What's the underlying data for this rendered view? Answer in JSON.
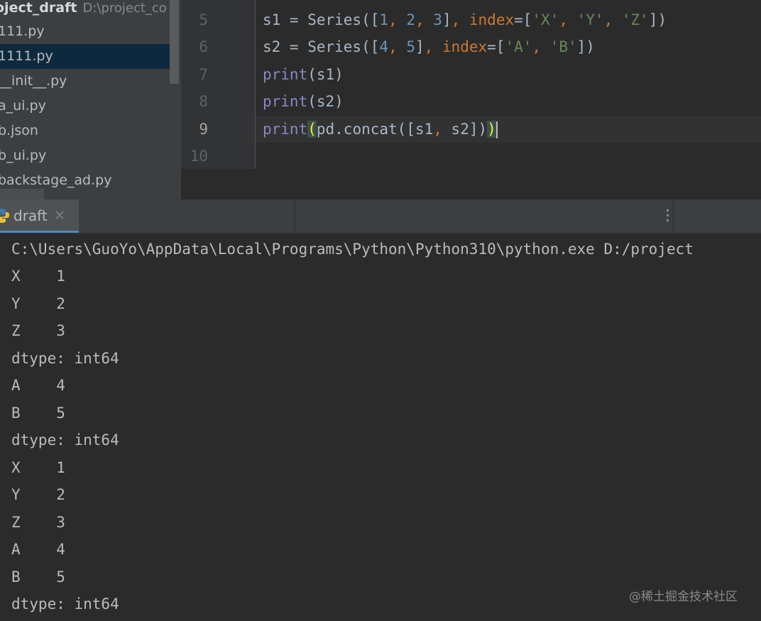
{
  "project": {
    "root_name": "oject_draft",
    "root_path": "D:\\project_co",
    "files": [
      {
        "name": "111.py",
        "selected": false
      },
      {
        "name": "1111.py",
        "selected": true
      },
      {
        "name": "__init__.py",
        "selected": false
      },
      {
        "name": "a_ui.py",
        "selected": false
      },
      {
        "name": "b.json",
        "selected": false
      },
      {
        "name": "b_ui.py",
        "selected": false
      },
      {
        "name": "backstage_ad.py",
        "selected": false
      }
    ]
  },
  "editor": {
    "line_numbers": [
      "5",
      "6",
      "7",
      "8",
      "9",
      "10"
    ],
    "current_line": "9",
    "lines": {
      "l5": {
        "a": "s1 = Series([",
        "n1": "1",
        "c1": ", ",
        "n2": "2",
        "c2": ", ",
        "n3": "3",
        "b": "]",
        "c3": ", ",
        "kw": "index",
        "eq": "=[",
        "s1": "'X'",
        "c4": ", ",
        "s2": "'Y'",
        "c5": ", ",
        "s3": "'Z'",
        "end": "])"
      },
      "l6": {
        "a": "s2 = Series([",
        "n1": "4",
        "c1": ", ",
        "n2": "5",
        "b": "]",
        "c2": ", ",
        "kw": "index",
        "eq": "=[",
        "s1": "'A'",
        "c3": ", ",
        "s2": "'B'",
        "end": "])"
      },
      "l7": {
        "fn": "print",
        "rest": "(s1)"
      },
      "l8": {
        "fn": "print",
        "rest": "(s2)"
      },
      "l9": {
        "fn": "print",
        "open": "(",
        "mid": "pd.concat([s1",
        "c1": ", ",
        "mid2": "s2])",
        "close": ")"
      }
    }
  },
  "run": {
    "tab_label": "draft",
    "console_lines": [
      "C:\\Users\\GuoYo\\AppData\\Local\\Programs\\Python\\Python310\\python.exe D:/project",
      "X    1",
      "Y    2",
      "Z    3",
      "dtype: int64",
      "A    4",
      "B    5",
      "dtype: int64",
      "X    1",
      "Y    2",
      "Z    3",
      "A    4",
      "B    5",
      "dtype: int64"
    ]
  },
  "watermark": "@稀土掘金技术社区",
  "colors": {
    "background": "#2b2b2b",
    "panel": "#3c3f41",
    "selection": "#0d293e",
    "keyword": "#cc7832",
    "string": "#6a8759",
    "number": "#6897bb",
    "builtin": "#8888c6"
  }
}
